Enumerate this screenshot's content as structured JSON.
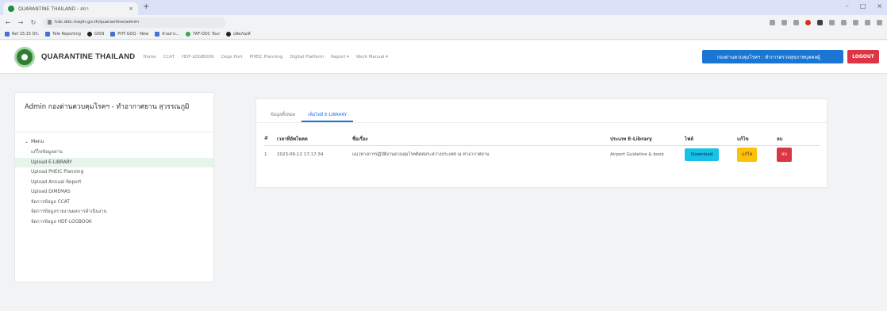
{
  "browser": {
    "tab_title": "QUARANTINE THAILAND - สถา",
    "tab_close": "×",
    "new_tab": "+",
    "window_controls": [
      "–",
      "□",
      "×"
    ],
    "url": "hdc.ddc.moph.go.th/quarantine/admin",
    "bookmarks": [
      "Ref 15:15 Dh.",
      "Tele Reporting",
      "GISN",
      "PHT-GOQ - New",
      "ตัวอย่าง...",
      "TAF-DDC Tour",
      "ผลิตภัณฑ์"
    ]
  },
  "navbar": {
    "brand": "QUARANTINE THAILAND",
    "menu": [
      "Home",
      "CCAT",
      "HDF-LOGBOOK",
      "Dogs Port",
      "PHEIC Planning",
      "Digital Platform",
      "Report ▾",
      "Work Manual ▾"
    ],
    "user_label": "กองด่านควบคุมโรคฯ : ทำการตรวจสุขภาพบุคคลผู้",
    "logout_label": "LOGOUT"
  },
  "sidebar": {
    "heading": "Admin กองด่านควบคุมโรคฯ - ทำอากาศยาน สุวรรณภูมิ",
    "menu_title": "Menu",
    "items": [
      "แก้ไขข้อมูลด่าน",
      "Upload E-LIBRARY",
      "Upload PHEIC Planning",
      "Upload Annual Report",
      "Upload DIMEMAS",
      "จัดการข้อมูล CCAT",
      "จัดการข้อมูลรายงานผลการดำเนินงาน",
      "จัดการข้อมูล HDF-LOGBOOK"
    ],
    "active_index": 1
  },
  "main": {
    "tabs": [
      "ข้อมูลทั้งหมด",
      "เพิ่มไฟล์ E-LIBRARY"
    ],
    "active_tab": 1,
    "table": {
      "headers": [
        "#",
        "เวลาที่อัพโหลด",
        "ชื่อเรื่อง",
        "ประเภท E-Library",
        "ไฟล์",
        "แก้ไข",
        "ลบ"
      ],
      "rows": [
        {
          "num": "1",
          "datetime": "2023-06-12 17:17:34",
          "title": "แนวทางการปฏิบัติงานควบคุมโรคติดต่อระหว่างประเทศ ณ ท่าอากาศยาน",
          "type": "Airport Guideline & book",
          "file_btn": "Download",
          "edit_btn": "แก้ไข",
          "delete_btn": "ลบ"
        }
      ]
    }
  },
  "colors": {
    "primary": "#1976d2",
    "danger": "#dc3545",
    "info": "#17c1e8",
    "warning": "#ffc107",
    "active_menu": "#e7f4ec"
  }
}
